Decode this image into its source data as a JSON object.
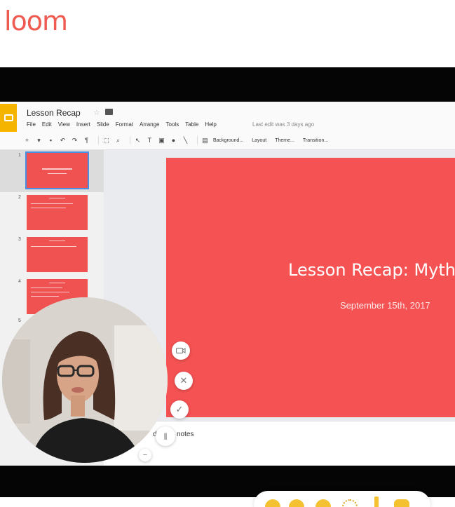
{
  "brand": {
    "logo_text": "loom",
    "color": "#ef5b51"
  },
  "slides_app": {
    "doc_title": "Lesson Recap",
    "menu": [
      "File",
      "Edit",
      "View",
      "Insert",
      "Slide",
      "Format",
      "Arrange",
      "Tools",
      "Table",
      "Help"
    ],
    "last_edit": "Last edit was 3 days ago",
    "toolbar": {
      "background_label": "Background...",
      "layout_label": "Layout",
      "theme_label": "Theme...",
      "transition_label": "Transition..."
    },
    "thumbnails": [
      {
        "number": "1",
        "active": true
      },
      {
        "number": "2",
        "active": false
      },
      {
        "number": "3",
        "active": false
      },
      {
        "number": "4",
        "active": false
      },
      {
        "number": "5",
        "active": false
      }
    ],
    "current_slide": {
      "title": "Lesson Recap: Myth",
      "subtitle": "September 15th, 2017",
      "color": "#f55253"
    },
    "notes_partial": "d sp",
    "notes_partial_2": "notes"
  },
  "recorder_controls": {
    "camera_icon": "video-camera-icon",
    "cancel_icon": "close-icon",
    "finish_icon": "check-icon",
    "pause_icon": "pause-icon",
    "collapse_icon": "minus-icon"
  },
  "reactions": [
    "smile-emoji",
    "laugh-emoji",
    "frown-emoji",
    "party-emoji",
    "exclamation-emoji",
    "thumbs-up-emoji"
  ]
}
